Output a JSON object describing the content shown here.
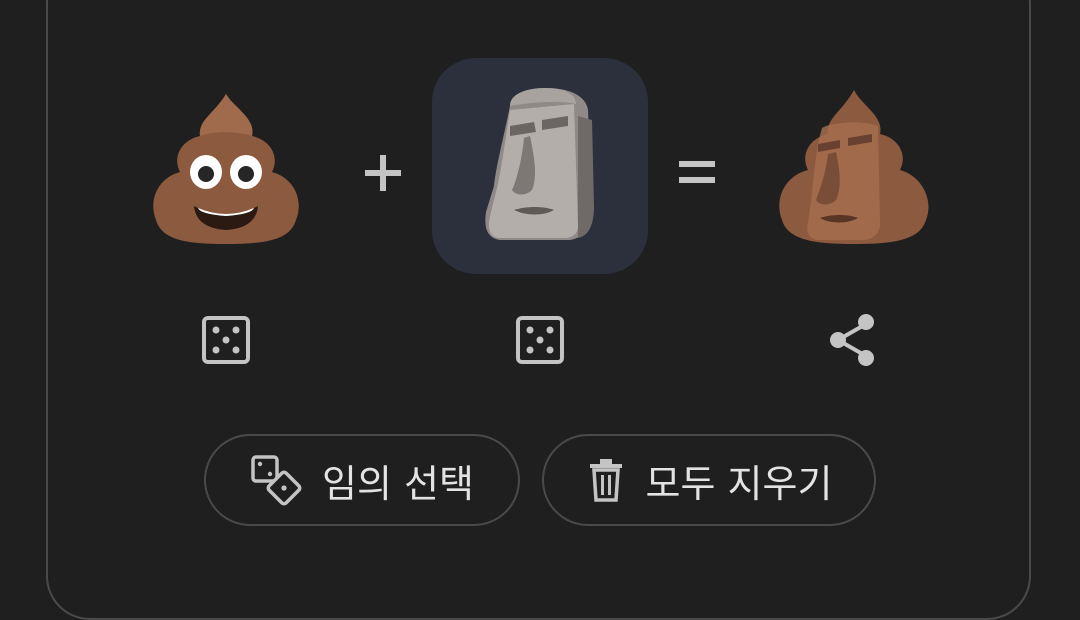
{
  "mixer": {
    "left_emoji": {
      "name": "pile-of-poo",
      "glyph": "💩"
    },
    "operator_plus": "+",
    "right_emoji": {
      "name": "moai",
      "glyph": "🗿"
    },
    "operator_equals": "=",
    "result_emoji": {
      "name": "poo-moai-mix"
    }
  },
  "actions": {
    "random_label": "임의 선택",
    "clear_label": "모두 지우기"
  },
  "icons": {
    "left_random": "dice-icon",
    "right_random": "dice-icon",
    "share": "share-icon",
    "random_button": "dice-pair-icon",
    "clear_button": "trash-icon"
  },
  "colors": {
    "background": "#1f1f1f",
    "border": "#4a4a4a",
    "selected_slot": "#2c303d",
    "icon": "#c4c4c4",
    "text": "#e3e3e3"
  }
}
